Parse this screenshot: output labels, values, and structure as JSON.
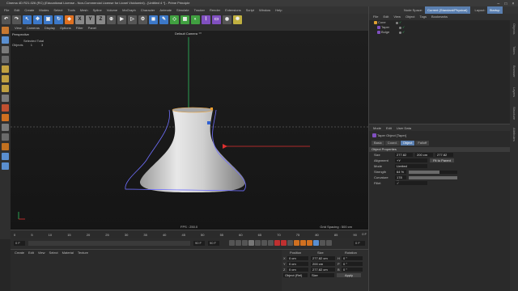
{
  "window": {
    "title": "Cinema 4D R21.026 (RC) (Educational License - Non-Commercial License for Lionel Vicidomini) - [Untitled 4 *] - Prime Principle",
    "controls": [
      "–",
      "□",
      "×"
    ]
  },
  "topmenu": [
    "File",
    "Edit",
    "Create",
    "Modes",
    "Select",
    "Tools",
    "Mesh",
    "Spline",
    "Volume",
    "MoGraph",
    "Character",
    "Animate",
    "Simulate",
    "Tracker",
    "Render",
    "Extensions",
    "Script",
    "Window",
    "Help"
  ],
  "toolbar": {
    "xyz": [
      "X",
      "Y",
      "Z"
    ]
  },
  "viewport": {
    "menu": [
      "View",
      "Cameras",
      "Display",
      "Options",
      "Filter",
      "Panel"
    ],
    "name": "Perspective",
    "camera": "Default Camera ⁺⁰",
    "info_title": "Selected Total",
    "info_objects_label": "Objects",
    "info_objects_selected": "1",
    "info_objects_total": "3",
    "fps": "FPS : 250.0",
    "grid_spacing": "Grid Spacing : 500 cm"
  },
  "timeline": {
    "ticks": [
      "0",
      "5",
      "10",
      "15",
      "20",
      "25",
      "30",
      "35",
      "40",
      "45",
      "50",
      "55",
      "60",
      "65",
      "70",
      "75",
      "80",
      "85",
      "90"
    ],
    "current_frame": "0 F",
    "start": "0 F",
    "end": "90 F",
    "end2": "90 F",
    "frame_right": "0 F"
  },
  "material": {
    "menu": [
      "Create",
      "Edit",
      "View",
      "Select",
      "Material",
      "Texture"
    ]
  },
  "coordinates": {
    "headers": [
      "Position",
      "Size",
      "Rotation"
    ],
    "rows": [
      {
        "axis": "X",
        "pos": "0 cm",
        "size": "277.82 cm",
        "rot_axis": "H",
        "rot": "0 °"
      },
      {
        "axis": "Y",
        "pos": "0 cm",
        "size": "200 cm",
        "rot_axis": "P",
        "rot": "0 °"
      },
      {
        "axis": "Z",
        "pos": "0 cm",
        "size": "277.82 cm",
        "rot_axis": "B",
        "rot": "0 °"
      }
    ],
    "mode": "Object (Rel)",
    "size_mode": "Size",
    "apply": "Apply"
  },
  "right": {
    "topbar_left": "Node Space:",
    "topbar_value": "Current (Standard/Physical)",
    "layout_label": "Layout:",
    "layout_value": "Startup",
    "objmenu": [
      "File",
      "Edit",
      "View",
      "Object",
      "Tags",
      "Bookmarks"
    ],
    "objects": [
      {
        "name": "Cone"
      },
      {
        "name": "Taper"
      },
      {
        "name": "Bulge"
      }
    ],
    "attrmenu": [
      "Mode",
      "Edit",
      "User Data"
    ],
    "attr_title": "Taper Object [Taper]",
    "tabs": [
      "Basic",
      "Coord.",
      "Object",
      "Falloff"
    ],
    "section": "Object Properties",
    "props": [
      {
        "label": "Size",
        "values": [
          "277.82 cm",
          "200 cm",
          "277.82 cm"
        ]
      },
      {
        "label": "Alignment",
        "values": [
          "+Y"
        ],
        "button": "Fit to Parent"
      },
      {
        "label": "Mode",
        "values": [
          "Limited"
        ]
      },
      {
        "label": "Strength",
        "values": [
          "64 %"
        ]
      },
      {
        "label": "Curvature",
        "values": [
          "178 %"
        ]
      },
      {
        "label": "Fillet",
        "values": [
          "✓"
        ]
      }
    ],
    "sidetabs": [
      "Objects",
      "Takes",
      "Content Browser",
      "Layers",
      "Structure",
      "Attributes"
    ]
  },
  "colors": {
    "accent": "#5a7fb0",
    "selection": "#f0a030",
    "axis_x": "#e03030",
    "axis_y": "#30c060",
    "deformer": "#7070ff"
  }
}
